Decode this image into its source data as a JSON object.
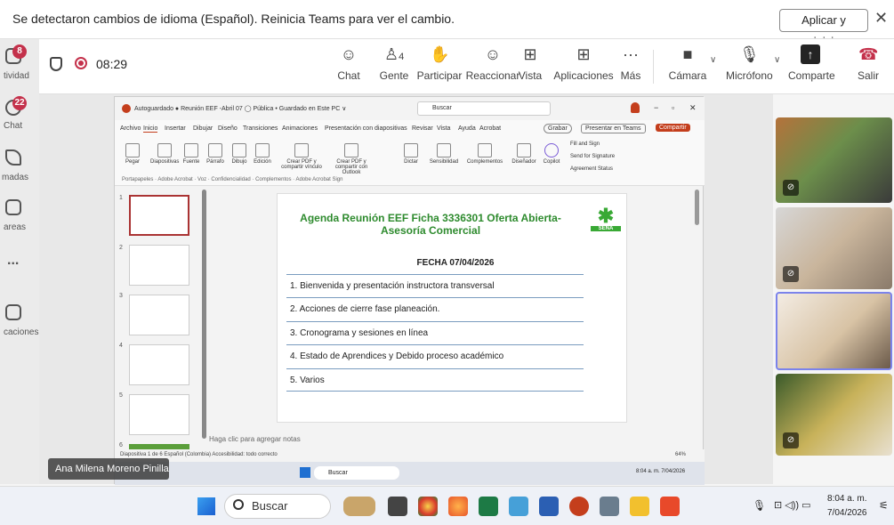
{
  "notification": {
    "message": "Se detectaron cambios de idioma (Español). Reinicia Teams para ver el cambio.",
    "apply_button": "Aplicar y reiniciar",
    "close": "✕"
  },
  "rail": {
    "items": [
      {
        "label": "tividad",
        "badge": "8"
      },
      {
        "label": "Chat",
        "badge": "22"
      },
      {
        "label": "madas",
        "badge": ""
      },
      {
        "label": "areas",
        "badge": ""
      },
      {
        "label": "...",
        "badge": ""
      },
      {
        "label": "caciones",
        "badge": ""
      }
    ]
  },
  "meeting": {
    "timer": "08:29",
    "chat": "Chat",
    "people": "Gente",
    "people_count": "4",
    "raise": "Participar",
    "react": "Reaccionar",
    "view": "Vista",
    "apps": "Aplicaciones",
    "more": "Más",
    "camera": "Cámara",
    "mic": "Micrófono",
    "share": "Comparte",
    "leave": "Salir"
  },
  "ppt": {
    "title": "Autoguardado  ●   Reunión EEF -Abril 07  ◯ Pública • Guardado en Este PC ∨",
    "search": "Buscar",
    "tabs": [
      "Archivo",
      "Inicio",
      "Insertar",
      "Dibujar",
      "Diseño",
      "Transiciones",
      "Animaciones",
      "Presentación con diapositivas",
      "Revisar",
      "Vista",
      "Ayuda",
      "Acrobat"
    ],
    "record": "Grabar",
    "present": "Presentar en Teams",
    "share": "Compartir",
    "ribbon": [
      "Pegar",
      "Diapositivas",
      "Fuente",
      "Párrafo",
      "Dibujo",
      "Edición",
      "Crear PDF y compartir vínculo",
      "Crear PDF y compartir con Outlook",
      "Dictar",
      "Sensibilidad",
      "Complementos",
      "Diseñador",
      "Copilot"
    ],
    "acrobat": [
      "Fill and Sign",
      "Send for Signature",
      "Agreement Status"
    ],
    "groups": "Portapapeles  ·  Adobe Acrobat  ·  Voz  ·  Confidencialidad  ·  Complementos  ·  Adobe Acrobat Sign",
    "thumb_nums": [
      "1",
      "2",
      "3",
      "4",
      "5",
      "6"
    ],
    "notes": "Haga clic para agregar notas",
    "status": "Diapositiva 1 de 6    Español (Colombia)    Accesibilidad: todo correcto",
    "zoom": "64%",
    "inner_clock": "8:04 a. m.  7/04/2026",
    "inner_search": "Buscar"
  },
  "slide": {
    "title": "Agenda Reunión EEF Ficha 3336301 Oferta Abierta-Asesoría Comercial",
    "date": "FECHA 07/04/2026",
    "logo": "SENA",
    "items": [
      "1. Bienvenida y presentación instructora transversal",
      "2. Acciones de cierre fase planeación.",
      "3. Cronograma y sesiones en línea",
      "4. Estado de Aprendices y Debido proceso académico",
      "5. Varios"
    ]
  },
  "presenter_name": "Ana Milena Moreno Pinilla",
  "taskbar": {
    "search": "Buscar",
    "time": "8:04 a. m.",
    "date": "7/04/2026"
  },
  "colors": {
    "accent": "#6264a7",
    "leave": "#c4314b",
    "sena": "#39a935"
  }
}
